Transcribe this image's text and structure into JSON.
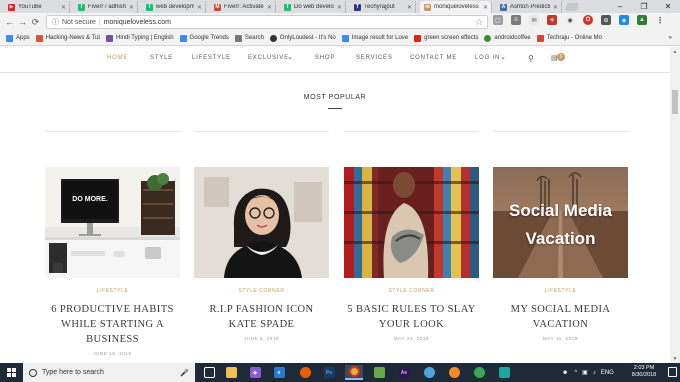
{
  "browser": {
    "tabs": [
      {
        "label": "YouTube",
        "color": "#e62117",
        "glyph": "▶"
      },
      {
        "label": "Fiverr / adhish",
        "color": "#1dbf73",
        "glyph": "f"
      },
      {
        "label": "web developme",
        "color": "#1dbf73",
        "glyph": "f"
      },
      {
        "label": "Fiverr: Activate",
        "color": "#d44638",
        "glyph": "M"
      },
      {
        "label": "Do web develop",
        "color": "#1dbf73",
        "glyph": "f"
      },
      {
        "label": "Techyrajput",
        "color": "#2d3a8c",
        "glyph": "T"
      },
      {
        "label": "moniqueloveless",
        "color": "#c79b5b",
        "glyph": "m"
      },
      {
        "label": "Ashton Predictio",
        "color": "#4a6fa5",
        "glyph": "A"
      }
    ],
    "window_controls": {
      "minimize": "–",
      "maximize": "❐",
      "close": "✕"
    },
    "nav": {
      "back": "←",
      "forward": "→",
      "reload": "⟳"
    },
    "address": {
      "security": "Not secure",
      "url": "moniqueloveless.com"
    },
    "bookmarks": [
      {
        "label": "Apps",
        "color": "#4285f4"
      },
      {
        "label": "Hacking-News & Tut",
        "color": "#e74c3c"
      },
      {
        "label": "Hindi Typing | English",
        "color": "#7b4fa0"
      },
      {
        "label": "Google Trends",
        "color": "#4285f4"
      },
      {
        "label": "Search",
        "color": "#777777"
      },
      {
        "label": "OnlyLoudest - It's No",
        "color": "#333333"
      },
      {
        "label": "Image result for Love",
        "color": "#4285f4"
      },
      {
        "label": "green screen effects",
        "color": "#e62117"
      },
      {
        "label": "androidcoffee",
        "color": "#3c8d2f"
      },
      {
        "label": "Techraju - Online Mo",
        "color": "#d44638"
      }
    ],
    "bookmarks_more": "»"
  },
  "site": {
    "nav": [
      "HOME",
      "STYLE",
      "LIFESTYLE",
      "EXCLUSIVE",
      "SHOP",
      "SERVICES",
      "CONTACT ME",
      "LOG IN"
    ],
    "exclusive_caret": "⌄",
    "login_caret": "⌄",
    "cart_count": "0",
    "accent": "#c79b5b"
  },
  "section": {
    "title": "MOST POPULAR"
  },
  "posts": [
    {
      "category": "LIFESTYLE",
      "title": "6 PRODUCTIVE HABITS WHILE STARTING A BUSINESS",
      "date": "JUNE 18, 2018",
      "image": "workspace",
      "screen_text": "DO MORE."
    },
    {
      "category": "STYLE CORNER",
      "title": "R.I.P FASHION ICON KATE SPADE",
      "date": "JUNE 6, 2018",
      "image": "portrait"
    },
    {
      "category": "STYLE CORNER",
      "title": "5 BASIC RULES TO SLAY YOUR LOOK",
      "date": "MAY 24, 2018",
      "image": "fashion"
    },
    {
      "category": "LIFESTYLE",
      "title": "MY SOCIAL MEDIA VACATION",
      "date": "MAY 11, 2018",
      "image": "road",
      "overlay_text": "Social Media Vacation"
    }
  ],
  "taskbar": {
    "search_placeholder": "Type here to search",
    "apps": [
      {
        "name": "task-view",
        "color": "#ffffff",
        "glyph": "▭"
      },
      {
        "name": "file-explorer",
        "color": "#f2c14e",
        "glyph": "▬"
      },
      {
        "name": "visual-studio",
        "color": "#8a5bd6",
        "glyph": "◆"
      },
      {
        "name": "edge",
        "color": "#2a7ad5",
        "glyph": "e"
      },
      {
        "name": "firefox",
        "color": "#e66000",
        "glyph": "◉"
      },
      {
        "name": "photoshop",
        "color": "#1f3b5c",
        "glyph": "Ps"
      },
      {
        "name": "chrome",
        "color": "#e5b13a",
        "glyph": "◎"
      },
      {
        "name": "installer",
        "color": "#6aa84f",
        "glyph": "▣"
      },
      {
        "name": "after-effects",
        "color": "#2b1a4d",
        "glyph": "Ae"
      },
      {
        "name": "app-blue",
        "color": "#49a7e0",
        "glyph": "◐"
      },
      {
        "name": "app-orange",
        "color": "#f28c28",
        "glyph": "◍"
      },
      {
        "name": "app-green",
        "color": "#3aa657",
        "glyph": "◑"
      },
      {
        "name": "app-teal",
        "color": "#1ea4a4",
        "glyph": "▦"
      }
    ],
    "language": "ENG",
    "time": "2:03 PM",
    "date": "8/30/2018"
  }
}
